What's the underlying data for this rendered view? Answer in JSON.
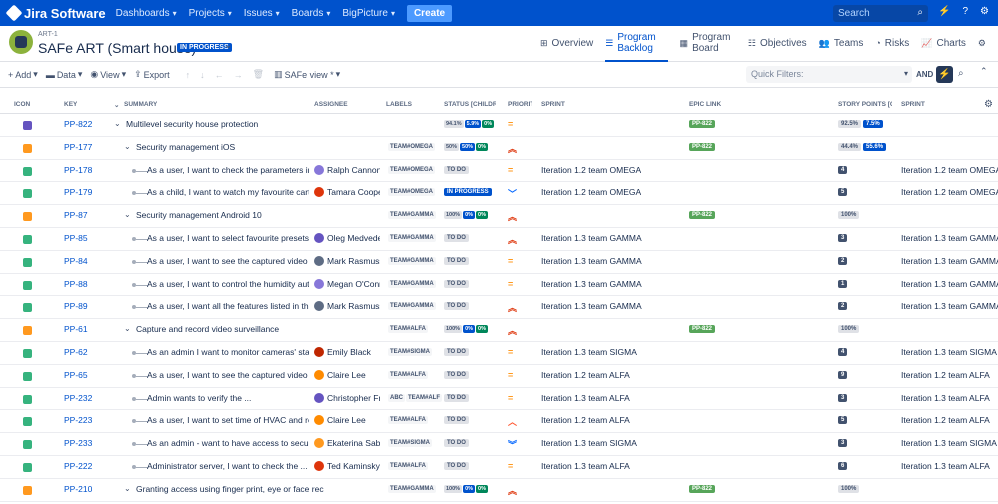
{
  "nav": {
    "logo": "Jira Software",
    "items": [
      "Dashboards",
      "Projects",
      "Issues",
      "Boards",
      "BigPicture"
    ],
    "create": "Create",
    "search_placeholder": "Search"
  },
  "header": {
    "key": "ART-1",
    "title": "SAFe ART (Smart house)",
    "status": "IN PROGRESS",
    "tabs": [
      {
        "label": "Overview",
        "icon": "hierarchy-icon"
      },
      {
        "label": "Program Backlog",
        "icon": "list-icon",
        "active": true
      },
      {
        "label": "Program Board",
        "icon": "board-icon"
      },
      {
        "label": "Objectives",
        "icon": "objectives-icon"
      },
      {
        "label": "Teams",
        "icon": "teams-icon"
      },
      {
        "label": "Risks",
        "icon": "risks-icon"
      },
      {
        "label": "Charts",
        "icon": "charts-icon"
      }
    ]
  },
  "toolbar": {
    "add": "Add",
    "data": "Data",
    "view": "View",
    "export": "Export",
    "view_select": "SAFe view *",
    "quick_filters_placeholder": "Quick Filters:",
    "and_label": "AND"
  },
  "columns": {
    "icon": "ICON",
    "key": "KEY",
    "summary": "SUMMARY",
    "assignee": "ASSIGNEE",
    "labels": "LABELS",
    "status": "STATUS [CHILDREN]",
    "priority": "PRIORITY",
    "sprint": "SPRINT",
    "epic_link": "EPIC LINK",
    "story_points": "STORY POINTS [CHILDREN]",
    "sprint2": "SPRINT"
  },
  "colors": {
    "primary": "#0052cc",
    "epic": "#6554c0",
    "feature": "#ff991f",
    "story": "#36b37e",
    "epic_link": "#57a55a"
  },
  "rows": [
    {
      "type": "epic",
      "key": "PP-822",
      "level": 0,
      "caret": true,
      "summary": "Multilevel security house protection",
      "assignee": "",
      "labels": [],
      "status_pct": [
        "94.1%",
        "5.9%",
        "0%"
      ],
      "priority": "medium",
      "sprint": "",
      "epic_link": "PP-822",
      "sp_pct": [
        "92.5%",
        "7.5%"
      ],
      "sp": "",
      "sprint2": ""
    },
    {
      "type": "feature",
      "key": "PP-177",
      "level": 1,
      "caret": true,
      "summary": "Security management iOS",
      "assignee": "",
      "labels": [
        "TEAM#OMEGA"
      ],
      "status_pct": [
        "50%",
        "50%",
        "0%"
      ],
      "priority": "high",
      "sprint": "",
      "epic_link": "PP-822",
      "sp_pct": [
        "44.4%",
        "55.6%"
      ],
      "sp": "",
      "sprint2": ""
    },
    {
      "type": "story",
      "key": "PP-178",
      "level": 2,
      "caret": false,
      "summary": "As a user, I want to check the parameters in all",
      "assignee": "Ralph Cannon",
      "av": "#8777d9",
      "labels": [
        "TEAM#OMEGA"
      ],
      "status": "TO DO",
      "priority": "medium",
      "sprint": "Iteration 1.2 team OMEGA",
      "epic_link": "",
      "sp": "4",
      "sprint2": "Iteration 1.2 team OMEGA"
    },
    {
      "type": "story",
      "key": "PP-179",
      "level": 2,
      "caret": false,
      "summary": "As a child, I want to watch my favourite cartoo",
      "assignee": "Tamara Cooper",
      "av": "#de350b",
      "labels": [
        "TEAM#OMEGA"
      ],
      "status": "IN PROGRESS",
      "priority": "low",
      "sprint": "Iteration 1.2 team OMEGA",
      "epic_link": "",
      "sp": "5",
      "sprint2": "Iteration 1.2 team OMEGA"
    },
    {
      "type": "feature",
      "key": "PP-87",
      "level": 1,
      "caret": true,
      "summary": "Security management Android 10",
      "assignee": "",
      "labels": [
        "TEAM#GAMMA"
      ],
      "status_pct": [
        "100%",
        "0%",
        "0%"
      ],
      "priority": "high",
      "sprint": "",
      "epic_link": "PP-822",
      "sp_pct": [
        "100%"
      ],
      "sp": "",
      "sprint2": ""
    },
    {
      "type": "story",
      "key": "PP-85",
      "level": 2,
      "caret": false,
      "summary": "As a user, I want to select favourite presets wh",
      "assignee": "Oleg Medvedev",
      "av": "#6554c0",
      "labels": [
        "TEAM#GAMMA"
      ],
      "status": "TO DO",
      "priority": "high",
      "sprint": "Iteration 1.3 team GAMMA",
      "epic_link": "",
      "sp": "3",
      "sprint2": "Iteration 1.3 team GAMMA"
    },
    {
      "type": "story",
      "key": "PP-84",
      "level": 2,
      "caret": false,
      "summary": "As a user, I want to see the captured video on m",
      "assignee": "Mark Rasmussen",
      "av": "#5e6c84",
      "labels": [
        "TEAM#GAMMA"
      ],
      "status": "TO DO",
      "priority": "medium",
      "sprint": "Iteration 1.3 team GAMMA",
      "epic_link": "",
      "sp": "2",
      "sprint2": "Iteration 1.3 team GAMMA"
    },
    {
      "type": "story",
      "key": "PP-88",
      "level": 2,
      "caret": false,
      "summary": "As a user, I want to control the humidity autom",
      "assignee": "Megan O'Connor",
      "av": "#8777d9",
      "labels": [
        "TEAM#GAMMA"
      ],
      "status": "TO DO",
      "priority": "medium",
      "sprint": "Iteration 1.3 team GAMMA",
      "epic_link": "",
      "sp": "1",
      "sprint2": "Iteration 1.3 team GAMMA"
    },
    {
      "type": "story",
      "key": "PP-89",
      "level": 2,
      "caret": false,
      "summary": "As a user, I want all the features listed in the m",
      "assignee": "Mark Rasmussen",
      "av": "#5e6c84",
      "labels": [
        "TEAM#GAMMA"
      ],
      "status": "TO DO",
      "priority": "high",
      "sprint": "Iteration 1.3 team GAMMA",
      "epic_link": "",
      "sp": "2",
      "sprint2": "Iteration 1.3 team GAMMA"
    },
    {
      "type": "feature",
      "key": "PP-61",
      "level": 1,
      "caret": true,
      "summary": "Capture and record video surveillance",
      "assignee": "",
      "labels": [
        "TEAM#ALFA"
      ],
      "status_pct": [
        "100%",
        "0%",
        "0%"
      ],
      "priority": "high",
      "sprint": "",
      "epic_link": "PP-822",
      "sp_pct": [
        "100%"
      ],
      "sp": "",
      "sprint2": ""
    },
    {
      "type": "story",
      "key": "PP-62",
      "level": 2,
      "caret": false,
      "summary": "As an admin I want to monitor cameras' status",
      "assignee": "Emily Black",
      "av": "#bf2600",
      "labels": [
        "TEAM#SIGMA"
      ],
      "status": "TO DO",
      "priority": "medium",
      "sprint": "Iteration 1.3 team SIGMA",
      "epic_link": "",
      "sp": "4",
      "sprint2": "Iteration 1.3 team SIGMA"
    },
    {
      "type": "story",
      "key": "PP-65",
      "level": 2,
      "caret": false,
      "summary": "As a user, I want to see the captured video on m",
      "assignee": "Claire Lee",
      "av": "#ff8b00",
      "labels": [
        "TEAM#ALFA"
      ],
      "status": "TO DO",
      "priority": "medium",
      "sprint": "Iteration 1.2 team ALFA",
      "epic_link": "",
      "sp": "9",
      "sprint2": "Iteration 1.2 team ALFA"
    },
    {
      "type": "story",
      "key": "PP-232",
      "level": 2,
      "caret": false,
      "summary": "Admin wants to verify the ...",
      "assignee": "Christopher Fre",
      "av": "#6554c0",
      "labels": [
        "ABC",
        "TEAM#ALF"
      ],
      "status": "TO DO",
      "priority": "medium",
      "sprint": "Iteration 1.3 team ALFA",
      "epic_link": "",
      "sp": "3",
      "sprint2": "Iteration 1.3 team ALFA"
    },
    {
      "type": "story",
      "key": "PP-223",
      "level": 2,
      "caret": false,
      "summary": "As a user, I want to set time of HVAC and recor",
      "assignee": "Claire Lee",
      "av": "#ff8b00",
      "labels": [
        "TEAM#ALFA"
      ],
      "status": "TO DO",
      "priority": "high-light",
      "sprint": "Iteration 1.2 team ALFA",
      "epic_link": "",
      "sp": "5",
      "sprint2": "Iteration 1.2 team ALFA"
    },
    {
      "type": "story",
      "key": "PP-233",
      "level": 2,
      "caret": false,
      "summary": "As an admin - want to have access to security r",
      "assignee": "Ekaterina Sabit",
      "av": "#ff991f",
      "labels": [
        "TEAM#SIGMA"
      ],
      "status": "TO DO",
      "priority": "lowest",
      "sprint": "Iteration 1.3 team SIGMA",
      "epic_link": "",
      "sp": "3",
      "sprint2": "Iteration 1.3 team SIGMA"
    },
    {
      "type": "story",
      "key": "PP-222",
      "level": 2,
      "caret": false,
      "summary": "Administrator server, I want to check the ...",
      "assignee": "Ted Kaminsky",
      "av": "#de350b",
      "labels": [
        "TEAM#ALFA"
      ],
      "status": "TO DO",
      "priority": "medium",
      "sprint": "Iteration 1.3 team ALFA",
      "epic_link": "",
      "sp": "6",
      "sprint2": "Iteration 1.3 team ALFA"
    },
    {
      "type": "feature",
      "key": "PP-210",
      "level": 1,
      "caret": true,
      "summary": "Granting access using finger print, eye or face rec",
      "assignee": "",
      "labels": [
        "TEAM#GAMMA"
      ],
      "status_pct": [
        "100%",
        "0%",
        "0%"
      ],
      "priority": "high",
      "sprint": "",
      "epic_link": "PP-822",
      "sp_pct": [
        "100%"
      ],
      "sp": "",
      "sprint2": ""
    }
  ]
}
